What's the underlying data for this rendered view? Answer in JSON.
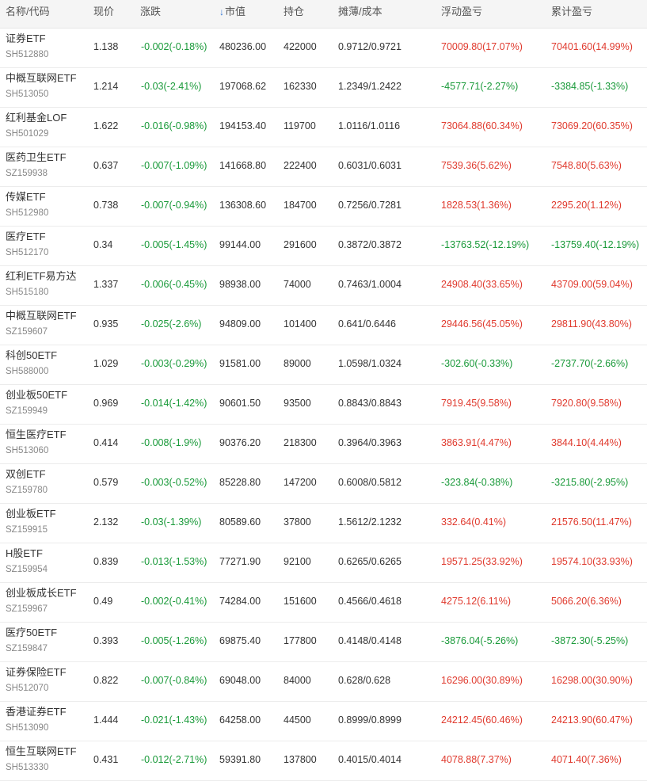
{
  "header": {
    "name": "名称/代码",
    "price": "现价",
    "change": "涨跌",
    "market_value": "市值",
    "sort_arrow": "↓",
    "holding": "持仓",
    "cost": "摊薄/成本",
    "float_pl": "浮动盈亏",
    "cum_pl": "累计盈亏"
  },
  "colors": {
    "up": "#e03a2e",
    "down": "#1a9a3a",
    "sort_arrow": "#3a7bd5"
  },
  "rows": [
    {
      "name": "证券ETF",
      "code": "SH512880",
      "price": "1.138",
      "change": "-0.002(-0.18%)",
      "market_value": "480236.00",
      "holding": "422000",
      "cost": "0.9712/0.9721",
      "float_pl": "70009.80(17.07%)",
      "cum_pl": "70401.60(14.99%)",
      "float_dir": "up",
      "cum_dir": "up"
    },
    {
      "name": "中概互联网ETF",
      "code": "SH513050",
      "price": "1.214",
      "change": "-0.03(-2.41%)",
      "market_value": "197068.62",
      "holding": "162330",
      "cost": "1.2349/1.2422",
      "float_pl": "-4577.71(-2.27%)",
      "cum_pl": "-3384.85(-1.33%)",
      "float_dir": "down",
      "cum_dir": "down"
    },
    {
      "name": "红利基金LOF",
      "code": "SH501029",
      "price": "1.622",
      "change": "-0.016(-0.98%)",
      "market_value": "194153.40",
      "holding": "119700",
      "cost": "1.0116/1.0116",
      "float_pl": "73064.88(60.34%)",
      "cum_pl": "73069.20(60.35%)",
      "float_dir": "up",
      "cum_dir": "up"
    },
    {
      "name": "医药卫生ETF",
      "code": "SZ159938",
      "price": "0.637",
      "change": "-0.007(-1.09%)",
      "market_value": "141668.80",
      "holding": "222400",
      "cost": "0.6031/0.6031",
      "float_pl": "7539.36(5.62%)",
      "cum_pl": "7548.80(5.63%)",
      "float_dir": "up",
      "cum_dir": "up"
    },
    {
      "name": "传媒ETF",
      "code": "SH512980",
      "price": "0.738",
      "change": "-0.007(-0.94%)",
      "market_value": "136308.60",
      "holding": "184700",
      "cost": "0.7256/0.7281",
      "float_pl": "1828.53(1.36%)",
      "cum_pl": "2295.20(1.12%)",
      "float_dir": "up",
      "cum_dir": "up"
    },
    {
      "name": "医疗ETF",
      "code": "SH512170",
      "price": "0.34",
      "change": "-0.005(-1.45%)",
      "market_value": "99144.00",
      "holding": "291600",
      "cost": "0.3872/0.3872",
      "float_pl": "-13763.52(-12.19%)",
      "cum_pl": "-13759.40(-12.19%)",
      "float_dir": "down",
      "cum_dir": "down"
    },
    {
      "name": "红利ETF易方达",
      "code": "SH515180",
      "price": "1.337",
      "change": "-0.006(-0.45%)",
      "market_value": "98938.00",
      "holding": "74000",
      "cost": "0.7463/1.0004",
      "float_pl": "24908.40(33.65%)",
      "cum_pl": "43709.00(59.04%)",
      "float_dir": "up",
      "cum_dir": "up"
    },
    {
      "name": "中概互联网ETF",
      "code": "SZ159607",
      "price": "0.935",
      "change": "-0.025(-2.6%)",
      "market_value": "94809.00",
      "holding": "101400",
      "cost": "0.641/0.6446",
      "float_pl": "29446.56(45.05%)",
      "cum_pl": "29811.90(43.80%)",
      "float_dir": "up",
      "cum_dir": "up"
    },
    {
      "name": "科创50ETF",
      "code": "SH588000",
      "price": "1.029",
      "change": "-0.003(-0.29%)",
      "market_value": "91581.00",
      "holding": "89000",
      "cost": "1.0598/1.0324",
      "float_pl": "-302.60(-0.33%)",
      "cum_pl": "-2737.70(-2.66%)",
      "float_dir": "down",
      "cum_dir": "down"
    },
    {
      "name": "创业板50ETF",
      "code": "SZ159949",
      "price": "0.969",
      "change": "-0.014(-1.42%)",
      "market_value": "90601.50",
      "holding": "93500",
      "cost": "0.8843/0.8843",
      "float_pl": "7919.45(9.58%)",
      "cum_pl": "7920.80(9.58%)",
      "float_dir": "up",
      "cum_dir": "up"
    },
    {
      "name": "恒生医疗ETF",
      "code": "SH513060",
      "price": "0.414",
      "change": "-0.008(-1.9%)",
      "market_value": "90376.20",
      "holding": "218300",
      "cost": "0.3964/0.3963",
      "float_pl": "3863.91(4.47%)",
      "cum_pl": "3844.10(4.44%)",
      "float_dir": "up",
      "cum_dir": "up"
    },
    {
      "name": "双创ETF",
      "code": "SZ159780",
      "price": "0.579",
      "change": "-0.003(-0.52%)",
      "market_value": "85228.80",
      "holding": "147200",
      "cost": "0.6008/0.5812",
      "float_pl": "-323.84(-0.38%)",
      "cum_pl": "-3215.80(-2.95%)",
      "float_dir": "down",
      "cum_dir": "down"
    },
    {
      "name": "创业板ETF",
      "code": "SZ159915",
      "price": "2.132",
      "change": "-0.03(-1.39%)",
      "market_value": "80589.60",
      "holding": "37800",
      "cost": "1.5612/2.1232",
      "float_pl": "332.64(0.41%)",
      "cum_pl": "21576.50(11.47%)",
      "float_dir": "up",
      "cum_dir": "up"
    },
    {
      "name": "H股ETF",
      "code": "SZ159954",
      "price": "0.839",
      "change": "-0.013(-1.53%)",
      "market_value": "77271.90",
      "holding": "92100",
      "cost": "0.6265/0.6265",
      "float_pl": "19571.25(33.92%)",
      "cum_pl": "19574.10(33.93%)",
      "float_dir": "up",
      "cum_dir": "up"
    },
    {
      "name": "创业板成长ETF",
      "code": "SZ159967",
      "price": "0.49",
      "change": "-0.002(-0.41%)",
      "market_value": "74284.00",
      "holding": "151600",
      "cost": "0.4566/0.4618",
      "float_pl": "4275.12(6.11%)",
      "cum_pl": "5066.20(6.36%)",
      "float_dir": "up",
      "cum_dir": "up"
    },
    {
      "name": "医疗50ETF",
      "code": "SZ159847",
      "price": "0.393",
      "change": "-0.005(-1.26%)",
      "market_value": "69875.40",
      "holding": "177800",
      "cost": "0.4148/0.4148",
      "float_pl": "-3876.04(-5.26%)",
      "cum_pl": "-3872.30(-5.25%)",
      "float_dir": "down",
      "cum_dir": "down"
    },
    {
      "name": "证券保险ETF",
      "code": "SH512070",
      "price": "0.822",
      "change": "-0.007(-0.84%)",
      "market_value": "69048.00",
      "holding": "84000",
      "cost": "0.628/0.628",
      "float_pl": "16296.00(30.89%)",
      "cum_pl": "16298.00(30.90%)",
      "float_dir": "up",
      "cum_dir": "up"
    },
    {
      "name": "香港证券ETF",
      "code": "SH513090",
      "price": "1.444",
      "change": "-0.021(-1.43%)",
      "market_value": "64258.00",
      "holding": "44500",
      "cost": "0.8999/0.8999",
      "float_pl": "24212.45(60.46%)",
      "cum_pl": "24213.90(60.47%)",
      "float_dir": "up",
      "cum_dir": "up"
    },
    {
      "name": "恒生互联网ETF",
      "code": "SH513330",
      "price": "0.431",
      "change": "-0.012(-2.71%)",
      "market_value": "59391.80",
      "holding": "137800",
      "cost": "0.4015/0.4014",
      "float_pl": "4078.88(7.37%)",
      "cum_pl": "4071.40(7.36%)",
      "float_dir": "up",
      "cum_dir": "up"
    }
  ]
}
